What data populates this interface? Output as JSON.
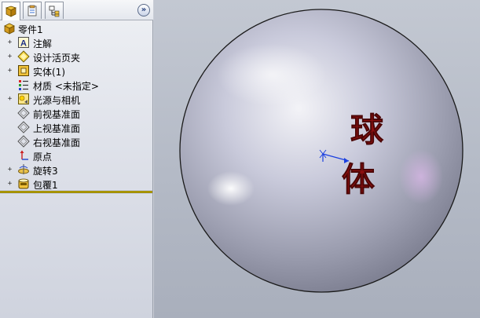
{
  "feature_manager": {
    "tabs": [
      {
        "name": "feature-manager-tab",
        "active": true
      },
      {
        "name": "property-manager-tab",
        "active": false
      },
      {
        "name": "configuration-manager-tab",
        "active": false
      }
    ],
    "collapse_label": "»",
    "tree": {
      "root_label": "零件1",
      "items": [
        {
          "label": "注解",
          "icon": "annotations-icon",
          "expandable": true
        },
        {
          "label": "设计活页夹",
          "icon": "design-binder-icon",
          "expandable": true
        },
        {
          "label": "实体(1)",
          "icon": "solid-bodies-icon",
          "expandable": true
        },
        {
          "label": "材质 <未指定>",
          "icon": "material-icon",
          "expandable": false
        },
        {
          "label": "光源与相机",
          "icon": "lights-cameras-icon",
          "expandable": true
        },
        {
          "label": "前视基准面",
          "icon": "plane-icon",
          "expandable": false
        },
        {
          "label": "上视基准面",
          "icon": "plane-icon",
          "expandable": false
        },
        {
          "label": "右视基准面",
          "icon": "plane-icon",
          "expandable": false
        },
        {
          "label": "原点",
          "icon": "origin-icon",
          "expandable": false
        },
        {
          "label": "旋转3",
          "icon": "revolve-feature-icon",
          "expandable": true
        },
        {
          "label": "包覆1",
          "icon": "wrap-feature-icon",
          "expandable": true
        }
      ]
    }
  },
  "viewport": {
    "model": "sphere",
    "wrapped_text": [
      "球",
      "体"
    ],
    "text_color": "#8b0f0f",
    "sphere_color": "#b9bcd0"
  }
}
